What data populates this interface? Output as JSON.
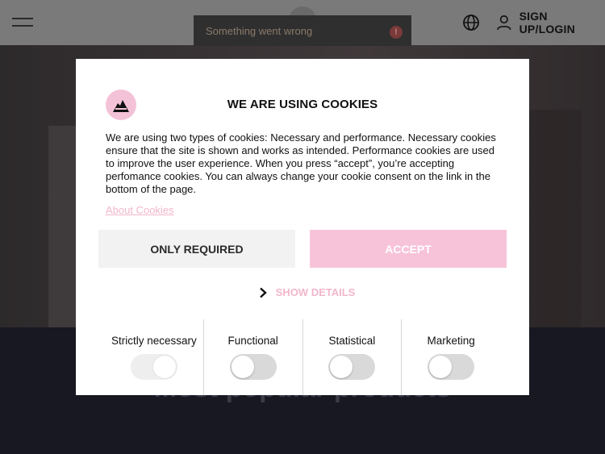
{
  "header": {
    "login_label": "SIGN UP/LOGIN"
  },
  "toast": {
    "message": "Something went wrong"
  },
  "background": {
    "section_title": "Most popular products"
  },
  "cookie_modal": {
    "title": "WE ARE USING COOKIES",
    "body": "We are using two types of cookies: Necessary and performance. Necessary cookies ensure that the site is shown and works as intended. Performance cookies are used to improve the user experience. When you press “accept”, you’re accepting perfomance cookies. You can always change your cookie consent on the link in the bottom of the page.",
    "about_link": "About Cookies",
    "only_required_label": "ONLY REQUIRED",
    "accept_label": "ACCEPT",
    "show_details_label": "SHOW DETAILS",
    "categories": [
      {
        "label": "Strictly necessary",
        "enabled": true
      },
      {
        "label": "Functional",
        "enabled": false
      },
      {
        "label": "Statistical",
        "enabled": false
      },
      {
        "label": "Marketing",
        "enabled": false
      }
    ]
  },
  "colors": {
    "accent_pink": "#f7c3d8",
    "link_pink": "#f2b6cc"
  },
  "icons": [
    "menu-icon",
    "globe-icon",
    "user-icon",
    "error-icon",
    "brand-logo",
    "chevron-right-icon"
  ]
}
